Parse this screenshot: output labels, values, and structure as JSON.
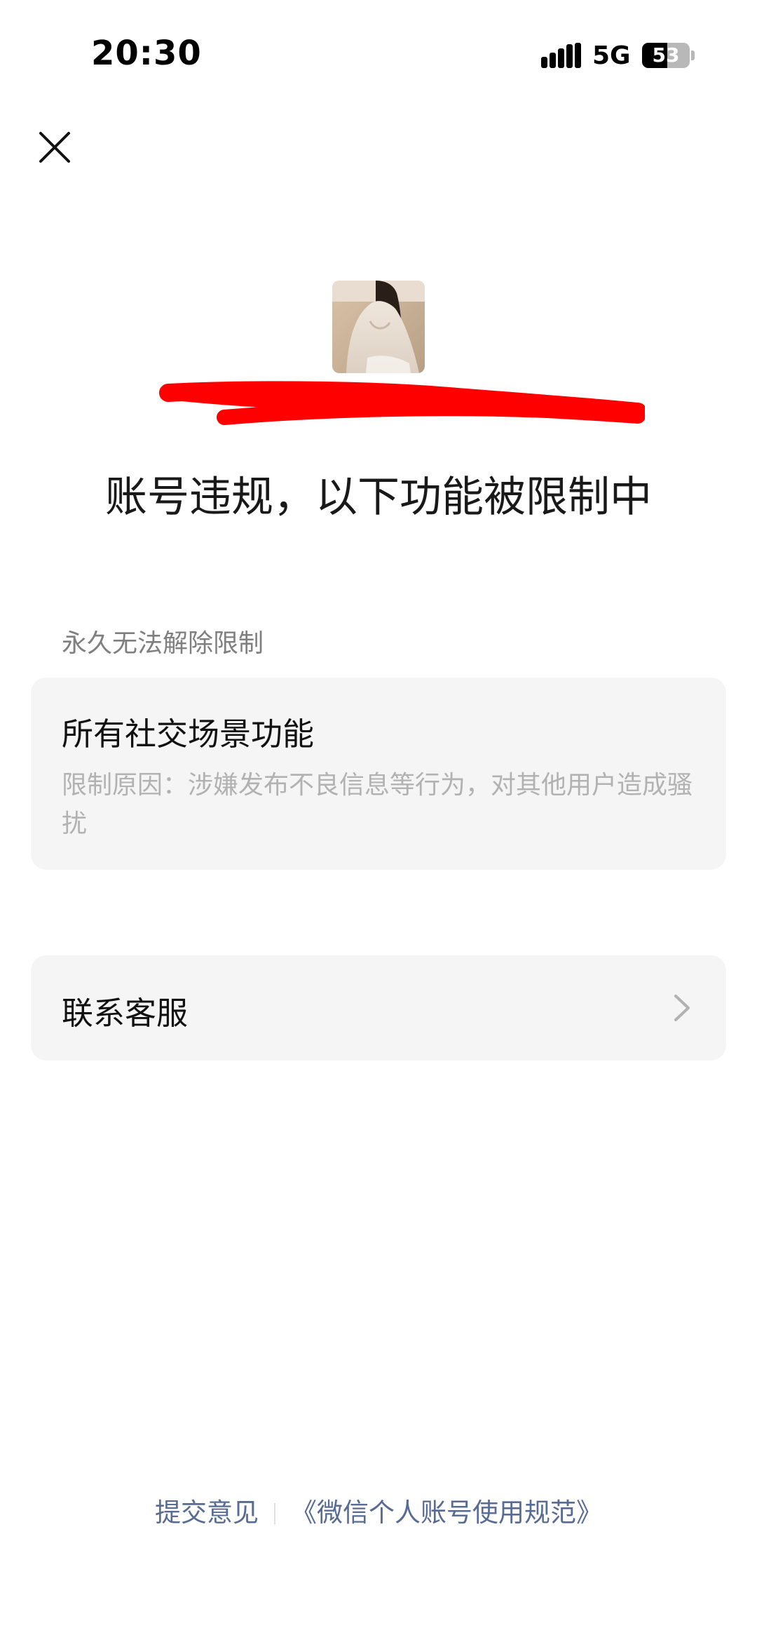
{
  "status_bar": {
    "time": "20:30",
    "network": "5G",
    "battery": "53",
    "battery_fraction": 0.53,
    "icons": [
      "signal-bars-icon",
      "battery-icon"
    ]
  },
  "header": {
    "close_icon": "close-icon"
  },
  "profile": {
    "avatar_icon": "avatar-photo"
  },
  "title": "账号违规，以下功能被限制中",
  "section": {
    "label": "永久无法解除限制"
  },
  "restriction": {
    "title": "所有社交场景功能",
    "reason": "限制原因：涉嫌发布不良信息等行为，对其他用户造成骚扰"
  },
  "support": {
    "label": "联系客服",
    "icon": "chevron-right-icon"
  },
  "footer": {
    "feedback_link": "提交意见",
    "policy_link": "《微信个人账号使用规范》"
  },
  "colors": {
    "link": "#576b95",
    "card_background": "#f5f5f5",
    "muted_text": "#7f7f7f",
    "reason_text": "#b2b2b2",
    "redaction": "#ff0000"
  }
}
